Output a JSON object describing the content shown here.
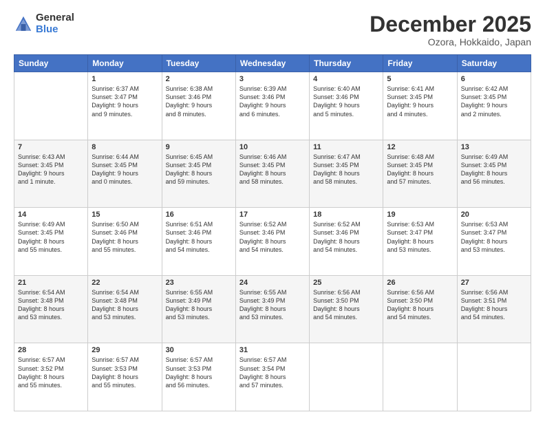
{
  "logo": {
    "general": "General",
    "blue": "Blue"
  },
  "title": "December 2025",
  "location": "Ozora, Hokkaido, Japan",
  "weekdays": [
    "Sunday",
    "Monday",
    "Tuesday",
    "Wednesday",
    "Thursday",
    "Friday",
    "Saturday"
  ],
  "weeks": [
    [
      {
        "day": "",
        "info": ""
      },
      {
        "day": "1",
        "info": "Sunrise: 6:37 AM\nSunset: 3:47 PM\nDaylight: 9 hours\nand 9 minutes."
      },
      {
        "day": "2",
        "info": "Sunrise: 6:38 AM\nSunset: 3:46 PM\nDaylight: 9 hours\nand 8 minutes."
      },
      {
        "day": "3",
        "info": "Sunrise: 6:39 AM\nSunset: 3:46 PM\nDaylight: 9 hours\nand 6 minutes."
      },
      {
        "day": "4",
        "info": "Sunrise: 6:40 AM\nSunset: 3:46 PM\nDaylight: 9 hours\nand 5 minutes."
      },
      {
        "day": "5",
        "info": "Sunrise: 6:41 AM\nSunset: 3:45 PM\nDaylight: 9 hours\nand 4 minutes."
      },
      {
        "day": "6",
        "info": "Sunrise: 6:42 AM\nSunset: 3:45 PM\nDaylight: 9 hours\nand 2 minutes."
      }
    ],
    [
      {
        "day": "7",
        "info": "Sunrise: 6:43 AM\nSunset: 3:45 PM\nDaylight: 9 hours\nand 1 minute."
      },
      {
        "day": "8",
        "info": "Sunrise: 6:44 AM\nSunset: 3:45 PM\nDaylight: 9 hours\nand 0 minutes."
      },
      {
        "day": "9",
        "info": "Sunrise: 6:45 AM\nSunset: 3:45 PM\nDaylight: 8 hours\nand 59 minutes."
      },
      {
        "day": "10",
        "info": "Sunrise: 6:46 AM\nSunset: 3:45 PM\nDaylight: 8 hours\nand 58 minutes."
      },
      {
        "day": "11",
        "info": "Sunrise: 6:47 AM\nSunset: 3:45 PM\nDaylight: 8 hours\nand 58 minutes."
      },
      {
        "day": "12",
        "info": "Sunrise: 6:48 AM\nSunset: 3:45 PM\nDaylight: 8 hours\nand 57 minutes."
      },
      {
        "day": "13",
        "info": "Sunrise: 6:49 AM\nSunset: 3:45 PM\nDaylight: 8 hours\nand 56 minutes."
      }
    ],
    [
      {
        "day": "14",
        "info": "Sunrise: 6:49 AM\nSunset: 3:45 PM\nDaylight: 8 hours\nand 55 minutes."
      },
      {
        "day": "15",
        "info": "Sunrise: 6:50 AM\nSunset: 3:46 PM\nDaylight: 8 hours\nand 55 minutes."
      },
      {
        "day": "16",
        "info": "Sunrise: 6:51 AM\nSunset: 3:46 PM\nDaylight: 8 hours\nand 54 minutes."
      },
      {
        "day": "17",
        "info": "Sunrise: 6:52 AM\nSunset: 3:46 PM\nDaylight: 8 hours\nand 54 minutes."
      },
      {
        "day": "18",
        "info": "Sunrise: 6:52 AM\nSunset: 3:46 PM\nDaylight: 8 hours\nand 54 minutes."
      },
      {
        "day": "19",
        "info": "Sunrise: 6:53 AM\nSunset: 3:47 PM\nDaylight: 8 hours\nand 53 minutes."
      },
      {
        "day": "20",
        "info": "Sunrise: 6:53 AM\nSunset: 3:47 PM\nDaylight: 8 hours\nand 53 minutes."
      }
    ],
    [
      {
        "day": "21",
        "info": "Sunrise: 6:54 AM\nSunset: 3:48 PM\nDaylight: 8 hours\nand 53 minutes."
      },
      {
        "day": "22",
        "info": "Sunrise: 6:54 AM\nSunset: 3:48 PM\nDaylight: 8 hours\nand 53 minutes."
      },
      {
        "day": "23",
        "info": "Sunrise: 6:55 AM\nSunset: 3:49 PM\nDaylight: 8 hours\nand 53 minutes."
      },
      {
        "day": "24",
        "info": "Sunrise: 6:55 AM\nSunset: 3:49 PM\nDaylight: 8 hours\nand 53 minutes."
      },
      {
        "day": "25",
        "info": "Sunrise: 6:56 AM\nSunset: 3:50 PM\nDaylight: 8 hours\nand 54 minutes."
      },
      {
        "day": "26",
        "info": "Sunrise: 6:56 AM\nSunset: 3:50 PM\nDaylight: 8 hours\nand 54 minutes."
      },
      {
        "day": "27",
        "info": "Sunrise: 6:56 AM\nSunset: 3:51 PM\nDaylight: 8 hours\nand 54 minutes."
      }
    ],
    [
      {
        "day": "28",
        "info": "Sunrise: 6:57 AM\nSunset: 3:52 PM\nDaylight: 8 hours\nand 55 minutes."
      },
      {
        "day": "29",
        "info": "Sunrise: 6:57 AM\nSunset: 3:53 PM\nDaylight: 8 hours\nand 55 minutes."
      },
      {
        "day": "30",
        "info": "Sunrise: 6:57 AM\nSunset: 3:53 PM\nDaylight: 8 hours\nand 56 minutes."
      },
      {
        "day": "31",
        "info": "Sunrise: 6:57 AM\nSunset: 3:54 PM\nDaylight: 8 hours\nand 57 minutes."
      },
      {
        "day": "",
        "info": ""
      },
      {
        "day": "",
        "info": ""
      },
      {
        "day": "",
        "info": ""
      }
    ]
  ]
}
